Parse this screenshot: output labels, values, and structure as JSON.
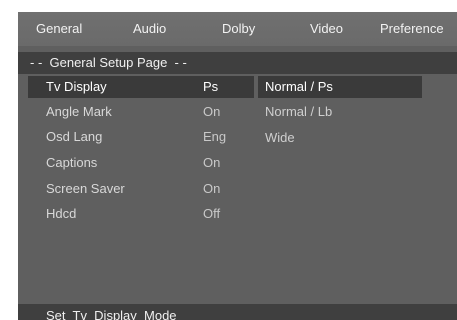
{
  "menu_bar": {
    "tabs": [
      {
        "label": "General"
      },
      {
        "label": "Audio"
      },
      {
        "label": "Dolby"
      },
      {
        "label": "Video"
      },
      {
        "label": "Preference"
      }
    ]
  },
  "page_title": "- -  General Setup Page  - -",
  "settings": [
    {
      "label": "Tv Display",
      "value": "Ps"
    },
    {
      "label": "Angle Mark",
      "value": "On"
    },
    {
      "label": "Osd Lang",
      "value": "Eng"
    },
    {
      "label": "Captions",
      "value": "On"
    },
    {
      "label": "Screen Saver",
      "value": "On"
    },
    {
      "label": "Hdcd",
      "value": "Off"
    }
  ],
  "options": [
    {
      "label": "Normal / Ps"
    },
    {
      "label": "Normal / Lb"
    },
    {
      "label": "Wide"
    }
  ],
  "status_text": "Set  Tv  Display  Mode",
  "colors": {
    "screen_bg": "#5f5f5f",
    "highlight_bg": "#3a3a3a",
    "header_bg": "#3f3f3f"
  }
}
